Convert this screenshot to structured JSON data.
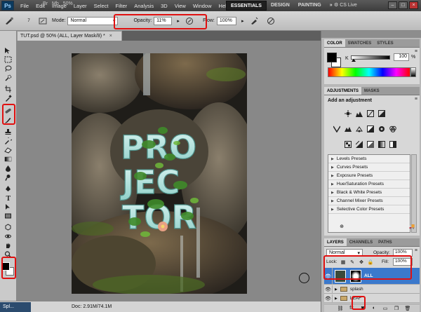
{
  "menubar": {
    "logo": "Ps",
    "items": [
      "File",
      "Edit",
      "Image",
      "Layer",
      "Select",
      "Filter",
      "Analysis",
      "3D",
      "View",
      "Window",
      "Help"
    ],
    "zoom": "50%",
    "workspaces": [
      "ESSENTIALS",
      "DESIGN",
      "PAINTING"
    ],
    "active_workspace": "ESSENTIALS",
    "cs_live": "CS Live"
  },
  "options_bar": {
    "brush_size": "7",
    "mode_label": "Mode:",
    "mode_value": "Normal",
    "opacity_label": "Opacity:",
    "opacity_value": "11%",
    "flow_label": "Flow:",
    "flow_value": "100%"
  },
  "document": {
    "tab_title": "TUT.psd @ 50% (ALL, Layer Mask/8) *",
    "artwork_text": [
      "PRO",
      "JEC",
      "TOR"
    ]
  },
  "statusbar": {
    "taskbar_label": "Spl...",
    "doc_info": "Doc: 2.91M/74.1M"
  },
  "color_panel": {
    "tabs": [
      "COLOR",
      "SWATCHES",
      "STYLES"
    ],
    "channel_label": "K",
    "channel_value": "100",
    "unit": "%"
  },
  "adjustments_panel": {
    "tabs": [
      "ADJUSTMENTS",
      "MASKS"
    ],
    "title": "Add an adjustment",
    "presets": [
      "Levels Presets",
      "Curves Presets",
      "Exposure Presets",
      "Hue/Saturation Presets",
      "Black & White Presets",
      "Channel Mixer Presets",
      "Selective Color Presets"
    ]
  },
  "layers_panel": {
    "tabs": [
      "LAYERS",
      "CHANNELS",
      "PATHS"
    ],
    "blend_mode": "Normal",
    "opacity_label": "Opacity:",
    "opacity_value": "100%",
    "lock_label": "Lock:",
    "fill_label": "Fill:",
    "fill_value": "100%",
    "layers": [
      {
        "name": "ALL",
        "selected": true
      },
      {
        "name": "splash",
        "selected": false
      },
      {
        "name": "LEAF",
        "selected": false
      }
    ]
  },
  "colors": {
    "highlight_red": "#e01010",
    "selected_layer": "#3b79cc"
  }
}
